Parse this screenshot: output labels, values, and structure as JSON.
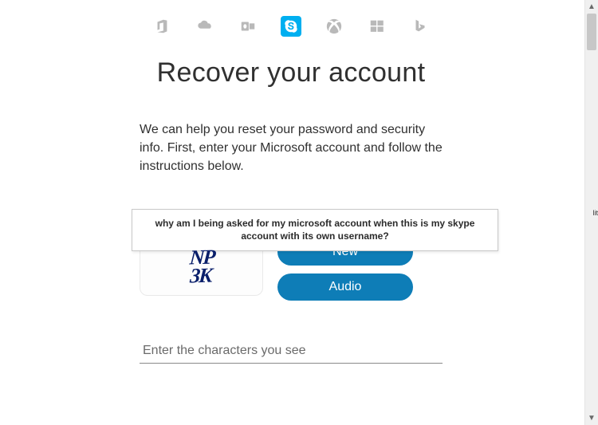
{
  "brand_icons": [
    {
      "name": "office-icon"
    },
    {
      "name": "onedrive-icon"
    },
    {
      "name": "outlook-icon"
    },
    {
      "name": "skype-icon",
      "active": true
    },
    {
      "name": "xbox-icon"
    },
    {
      "name": "windows-icon"
    },
    {
      "name": "bing-icon"
    }
  ],
  "title": "Recover your account",
  "helptext": "We can help you reset your password and security info. First, enter your Microsoft account and follow the instructions below.",
  "annotation_text": "why am I being asked for my microsoft account when this is my skype account with its own username?",
  "captcha": {
    "line1": "NP",
    "line2": "3K",
    "new_label": "New",
    "audio_label": "Audio"
  },
  "char_input_placeholder": "Enter the characters you see",
  "edge_label": "lit"
}
